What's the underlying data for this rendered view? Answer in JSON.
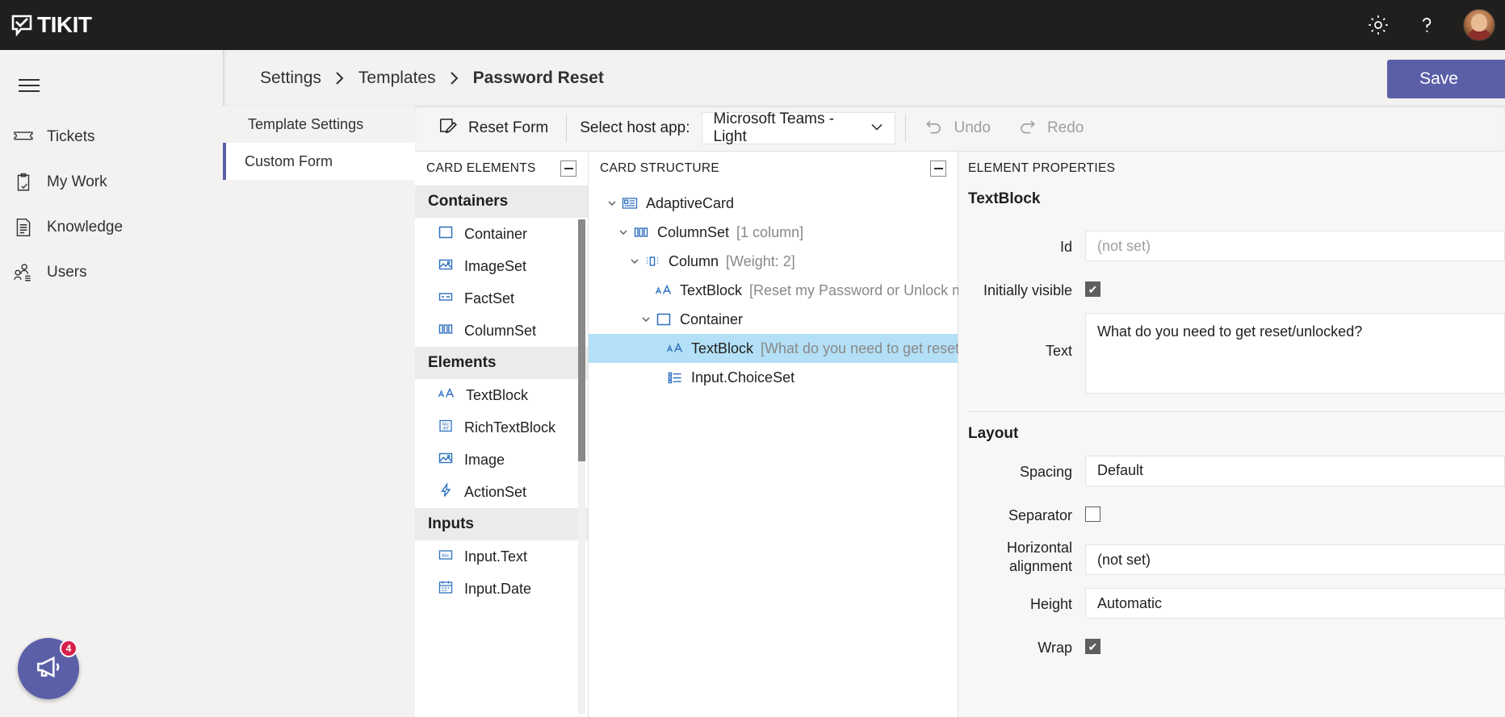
{
  "topbar": {
    "brand": "TIKIT",
    "brand_icon": "tikit-check-bubble-icon",
    "settings_icon": "gear-icon",
    "help_icon": "question-mark-icon",
    "avatar_alt": "user-avatar"
  },
  "sidebar": {
    "menu_icon": "hamburger-menu-icon",
    "items": [
      {
        "label": "Tickets",
        "icon": "ticket-icon"
      },
      {
        "label": "My Work",
        "icon": "clipboard-check-icon"
      },
      {
        "label": "Knowledge",
        "icon": "document-lines-icon"
      },
      {
        "label": "Users",
        "icon": "people-list-icon"
      }
    ],
    "feedback": {
      "icon": "megaphone-icon",
      "badge": "4"
    }
  },
  "header": {
    "breadcrumb": [
      {
        "label": "Settings",
        "current": false
      },
      {
        "label": "Templates",
        "current": false
      },
      {
        "label": "Password Reset",
        "current": true
      }
    ],
    "separator_icon": "chevron-right-icon",
    "save_label": "Save"
  },
  "subnav": {
    "items": [
      {
        "label": "Template Settings",
        "active": false
      },
      {
        "label": "Custom Form",
        "active": true
      }
    ]
  },
  "toolbar": {
    "reset_form_label": "Reset Form",
    "reset_form_icon": "edit-pencil-card-icon",
    "host_app_label": "Select host app:",
    "host_app_value": "Microsoft Teams - Light",
    "host_app_chevron": "chevron-down-icon",
    "undo_label": "Undo",
    "undo_icon": "undo-arrow-icon",
    "redo_label": "Redo",
    "redo_icon": "redo-arrow-icon"
  },
  "card_elements": {
    "title": "CARD ELEMENTS",
    "collapse_icon": "collapse-minus-icon",
    "groups": [
      {
        "name": "Containers",
        "items": [
          {
            "label": "Container",
            "icon": "square-outline-icon"
          },
          {
            "label": "ImageSet",
            "icon": "image-set-icon"
          },
          {
            "label": "FactSet",
            "icon": "fact-set-icon"
          },
          {
            "label": "ColumnSet",
            "icon": "column-set-icon"
          }
        ]
      },
      {
        "name": "Elements",
        "items": [
          {
            "label": "TextBlock",
            "icon": "text-block-icon"
          },
          {
            "label": "RichTextBlock",
            "icon": "rich-text-block-icon"
          },
          {
            "label": "Image",
            "icon": "image-icon"
          },
          {
            "label": "ActionSet",
            "icon": "lightning-bolt-icon"
          }
        ]
      },
      {
        "name": "Inputs",
        "items": [
          {
            "label": "Input.Text",
            "icon": "input-text-icon"
          },
          {
            "label": "Input.Date",
            "icon": "calendar-icon"
          }
        ]
      }
    ]
  },
  "card_structure": {
    "title": "CARD STRUCTURE",
    "collapse_icon": "collapse-minus-icon",
    "nodes": [
      {
        "label": "AdaptiveCard",
        "meta": "",
        "depth": 0,
        "icon": "adaptive-card-icon",
        "twisty": "chevron-down-icon",
        "selected": false
      },
      {
        "label": "ColumnSet",
        "meta": "[1 column]",
        "depth": 1,
        "icon": "column-set-icon",
        "twisty": "chevron-down-icon",
        "selected": false
      },
      {
        "label": "Column",
        "meta": "[Weight: 2]",
        "depth": 2,
        "icon": "column-icon",
        "twisty": "chevron-down-icon",
        "selected": false
      },
      {
        "label": "TextBlock",
        "meta": "[Reset my Password or Unlock my",
        "depth": 3,
        "icon": "text-block-icon",
        "twisty": "",
        "selected": false
      },
      {
        "label": "Container",
        "meta": "",
        "depth": 3,
        "icon": "square-outline-icon",
        "twisty": "chevron-down-icon",
        "selected": false
      },
      {
        "label": "TextBlock",
        "meta": "[What do you need to get reset/",
        "depth": 4,
        "icon": "text-block-icon",
        "twisty": "",
        "selected": true
      },
      {
        "label": "Input.ChoiceSet",
        "meta": "",
        "depth": 4,
        "icon": "choice-set-icon",
        "twisty": "",
        "selected": false
      }
    ]
  },
  "element_properties": {
    "title": "ELEMENT PROPERTIES",
    "element_type": "TextBlock",
    "fields": [
      {
        "label": "Id",
        "value": "(not set)",
        "kind": "text",
        "placeholder": true
      },
      {
        "label": "Initially visible",
        "value": "",
        "kind": "checkbox",
        "checked": true
      },
      {
        "label": "Text",
        "value": "What do you need to get reset/unlocked?",
        "kind": "textarea",
        "placeholder": false
      }
    ],
    "layout_section": "Layout",
    "layout_fields": [
      {
        "label": "Spacing",
        "value": "Default",
        "kind": "text",
        "placeholder": false
      },
      {
        "label": "Separator",
        "value": "",
        "kind": "checkbox",
        "checked": false
      },
      {
        "label": "Horizontal alignment",
        "value": "(not set)",
        "kind": "text",
        "placeholder": false
      },
      {
        "label": "Height",
        "value": "Automatic",
        "kind": "text",
        "placeholder": false
      },
      {
        "label": "Wrap",
        "value": "",
        "kind": "checkbox",
        "checked": true
      }
    ]
  },
  "colors": {
    "topbar_bg": "#201f1e",
    "accent_purple": "#5b5fa8",
    "selection_blue": "#b3e0f7",
    "icon_blue": "#2d6fbf",
    "badge_red": "#d6204a"
  }
}
